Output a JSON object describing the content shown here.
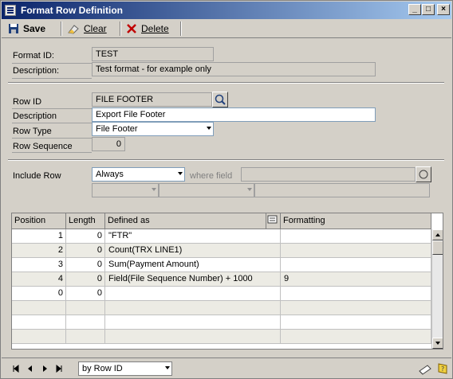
{
  "window": {
    "title": "Format Row Definition"
  },
  "title_buttons": {
    "minimize": "_",
    "maximize": "□",
    "close": "×"
  },
  "toolbar": {
    "save_label": "Save",
    "clear_label": "Clear",
    "delete_label": "Delete"
  },
  "header": {
    "format_id_label": "Format ID:",
    "format_id_value": "TEST",
    "description_label": "Description:",
    "description_value": "Test format - for example only"
  },
  "row": {
    "row_id_label": "Row ID",
    "row_id_value": "FILE FOOTER",
    "description_label": "Description",
    "description_value": "Export File Footer",
    "row_type_label": "Row Type",
    "row_type_value": "File Footer",
    "row_sequence_label": "Row Sequence",
    "row_sequence_value": "0"
  },
  "include": {
    "label": "Include Row",
    "value": "Always",
    "where_label": "where field"
  },
  "grid": {
    "columns": [
      "Position",
      "Length",
      "Defined as",
      "Formatting"
    ],
    "rows": [
      {
        "position": "1",
        "length": "0",
        "defined_as": "\"FTR\"",
        "formatting": ""
      },
      {
        "position": "2",
        "length": "0",
        "defined_as": "Count(TRX LINE1)",
        "formatting": ""
      },
      {
        "position": "3",
        "length": "0",
        "defined_as": "Sum(Payment Amount)",
        "formatting": ""
      },
      {
        "position": "4",
        "length": "0",
        "defined_as": "Field(File Sequence Number) + 1000",
        "formatting": "9"
      },
      {
        "position": "0",
        "length": "0",
        "defined_as": "",
        "formatting": ""
      }
    ]
  },
  "footer": {
    "sort_value": "by Row ID"
  },
  "icons": [
    "app-icon",
    "save-icon",
    "clear-icon",
    "delete-icon",
    "lookup-icon",
    "expand-icon",
    "first-icon",
    "previous-icon",
    "next-icon",
    "last-icon",
    "note-icon",
    "help-icon"
  ]
}
